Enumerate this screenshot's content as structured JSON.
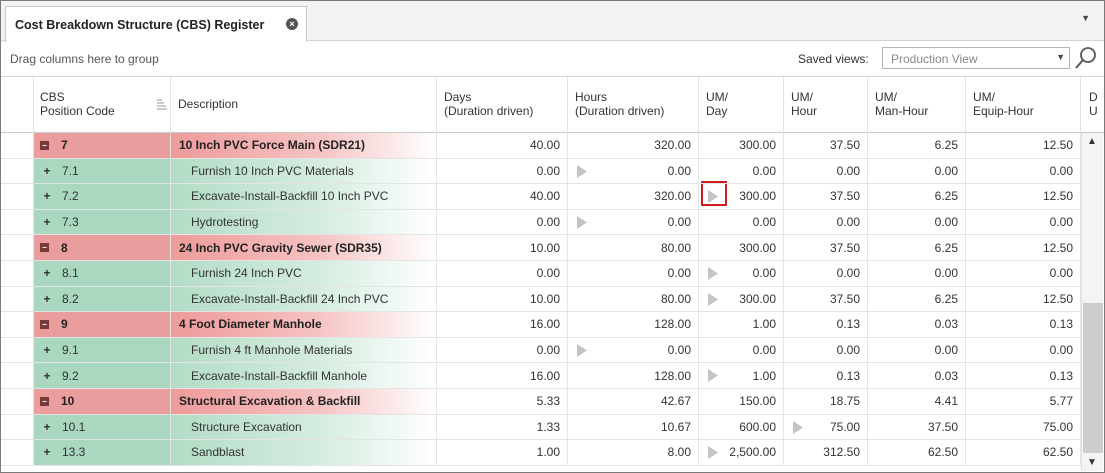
{
  "tab": {
    "title": "Cost Breakdown Structure (CBS) Register",
    "close_glyph": "×",
    "menu_glyph": "▼"
  },
  "toolbar": {
    "group_hint": "Drag columns here to group",
    "saved_views_label": "Saved views:",
    "saved_view_value": "Production View",
    "dropdown_glyph": "▼"
  },
  "columns": {
    "code": [
      "CBS",
      "Position Code"
    ],
    "description": "Description",
    "days": [
      "Days",
      "(Duration driven)"
    ],
    "hours": [
      "Hours",
      "(Duration driven)"
    ],
    "um_day": [
      "UM/",
      "Day"
    ],
    "um_hour": [
      "UM/",
      "Hour"
    ],
    "um_man_hour": [
      "UM/",
      "Man-Hour"
    ],
    "um_equip_hour": [
      "UM/",
      "Equip-Hour"
    ],
    "partial": [
      "D",
      "U"
    ]
  },
  "rows": [
    {
      "type": "parent",
      "expander": "−",
      "code": "7",
      "description": "10 Inch PVC Force Main (SDR21)",
      "days": "40.00",
      "hours": "320.00",
      "um_day": "300.00",
      "um_hour": "37.50",
      "um_man_hour": "6.25",
      "um_equip_hour": "12.50"
    },
    {
      "type": "child",
      "expander": "+",
      "code": "7.1",
      "description": "Furnish 10 Inch PVC Materials",
      "days": "0.00",
      "hours": "0.00",
      "um_day": "0.00",
      "um_hour": "0.00",
      "um_man_hour": "0.00",
      "um_equip_hour": "0.00",
      "play_in": "hours"
    },
    {
      "type": "child",
      "expander": "+",
      "code": "7.2",
      "description": "Excavate-Install-Backfill 10 Inch PVC",
      "days": "40.00",
      "hours": "320.00",
      "um_day": "300.00",
      "um_hour": "37.50",
      "um_man_hour": "6.25",
      "um_equip_hour": "12.50",
      "play_in": "um_day"
    },
    {
      "type": "child",
      "expander": "+",
      "code": "7.3",
      "description": "Hydrotesting",
      "days": "0.00",
      "hours": "0.00",
      "um_day": "0.00",
      "um_hour": "0.00",
      "um_man_hour": "0.00",
      "um_equip_hour": "0.00",
      "play_in": "hours"
    },
    {
      "type": "parent",
      "expander": "−",
      "code": "8",
      "description": "24 Inch PVC Gravity Sewer (SDR35)",
      "days": "10.00",
      "hours": "80.00",
      "um_day": "300.00",
      "um_hour": "37.50",
      "um_man_hour": "6.25",
      "um_equip_hour": "12.50"
    },
    {
      "type": "child",
      "expander": "+",
      "code": "8.1",
      "description": "Furnish 24 Inch PVC",
      "days": "0.00",
      "hours": "0.00",
      "um_day": "0.00",
      "um_hour": "0.00",
      "um_man_hour": "0.00",
      "um_equip_hour": "0.00",
      "play_in": "um_day"
    },
    {
      "type": "child",
      "expander": "+",
      "code": "8.2",
      "description": "Excavate-Install-Backfill 24 Inch PVC",
      "days": "10.00",
      "hours": "80.00",
      "um_day": "300.00",
      "um_hour": "37.50",
      "um_man_hour": "6.25",
      "um_equip_hour": "12.50",
      "play_in": "um_day"
    },
    {
      "type": "parent",
      "expander": "−",
      "code": "9",
      "description": "4 Foot Diameter Manhole",
      "days": "16.00",
      "hours": "128.00",
      "um_day": "1.00",
      "um_hour": "0.13",
      "um_man_hour": "0.03",
      "um_equip_hour": "0.13"
    },
    {
      "type": "child",
      "expander": "+",
      "code": "9.1",
      "description": "Furnish 4 ft Manhole Materials",
      "days": "0.00",
      "hours": "0.00",
      "um_day": "0.00",
      "um_hour": "0.00",
      "um_man_hour": "0.00",
      "um_equip_hour": "0.00",
      "play_in": "hours"
    },
    {
      "type": "child",
      "expander": "+",
      "code": "9.2",
      "description": "Excavate-Install-Backfill Manhole",
      "days": "16.00",
      "hours": "128.00",
      "um_day": "1.00",
      "um_hour": "0.13",
      "um_man_hour": "0.03",
      "um_equip_hour": "0.13",
      "play_in": "um_day"
    },
    {
      "type": "parent",
      "expander": "−",
      "code": "10",
      "description": "Structural Excavation & Backfill",
      "days": "5.33",
      "hours": "42.67",
      "um_day": "150.00",
      "um_hour": "18.75",
      "um_man_hour": "4.41",
      "um_equip_hour": "5.77"
    },
    {
      "type": "child",
      "expander": "+",
      "code": "10.1",
      "description": "Structure Excavation",
      "days": "1.33",
      "hours": "10.67",
      "um_day": "600.00",
      "um_hour": "75.00",
      "um_man_hour": "37.50",
      "um_equip_hour": "75.00",
      "play_in": "um_hour"
    },
    {
      "type": "child",
      "expander": "+",
      "code": "13.3",
      "description": "Sandblast",
      "days": "1.00",
      "hours": "8.00",
      "um_day": "2,500.00",
      "um_hour": "312.50",
      "um_man_hour": "62.50",
      "um_equip_hour": "62.50",
      "play_in": "um_day"
    }
  ],
  "scrollbar": {
    "up_glyph": "▲",
    "down_glyph": "▼"
  },
  "colors": {
    "parent_row": "#e99d9d",
    "child_row": "#a9d7bf",
    "highlight": "#d01c1c"
  },
  "icons": {
    "close": "close-icon",
    "search": "search-icon",
    "sort": "sort-icon",
    "play": "play-triangle-icon"
  }
}
